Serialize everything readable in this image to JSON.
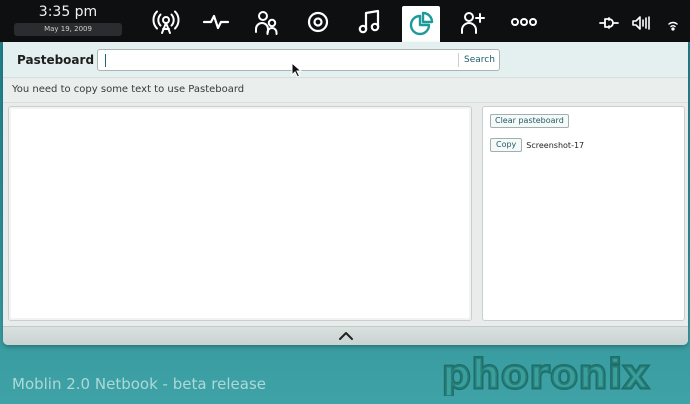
{
  "clock": {
    "time": "3:35 pm",
    "date": "May 19, 2009"
  },
  "toolbar": {
    "zones": [
      {
        "icon": "wireless-broadcast-icon"
      },
      {
        "icon": "activity-pulse-icon"
      },
      {
        "icon": "people-icon"
      },
      {
        "icon": "media-disc-icon"
      },
      {
        "icon": "music-note-icon"
      },
      {
        "icon": "pasteboard-icon",
        "active": true
      },
      {
        "icon": "add-person-icon"
      },
      {
        "icon": "applications-dots-icon"
      }
    ],
    "status": [
      {
        "icon": "power-plug-icon"
      },
      {
        "icon": "volume-icon"
      },
      {
        "icon": "wifi-icon"
      }
    ]
  },
  "panel": {
    "title": "Pasteboard",
    "search": {
      "value": "",
      "button_label": "Search"
    },
    "message": "You need to copy some text to use Pasteboard",
    "sidebar": {
      "clear_label": "Clear pasteboard",
      "items": [
        {
          "copy_label": "Copy",
          "label": "Screenshot-17"
        }
      ]
    }
  },
  "footer": {
    "caption": "Moblin 2.0 Netbook - beta release",
    "watermark": "phoronix"
  },
  "colors": {
    "accent": "#1f9a9a",
    "topbar": "#0e0f10",
    "panel": "#e9ecea"
  }
}
